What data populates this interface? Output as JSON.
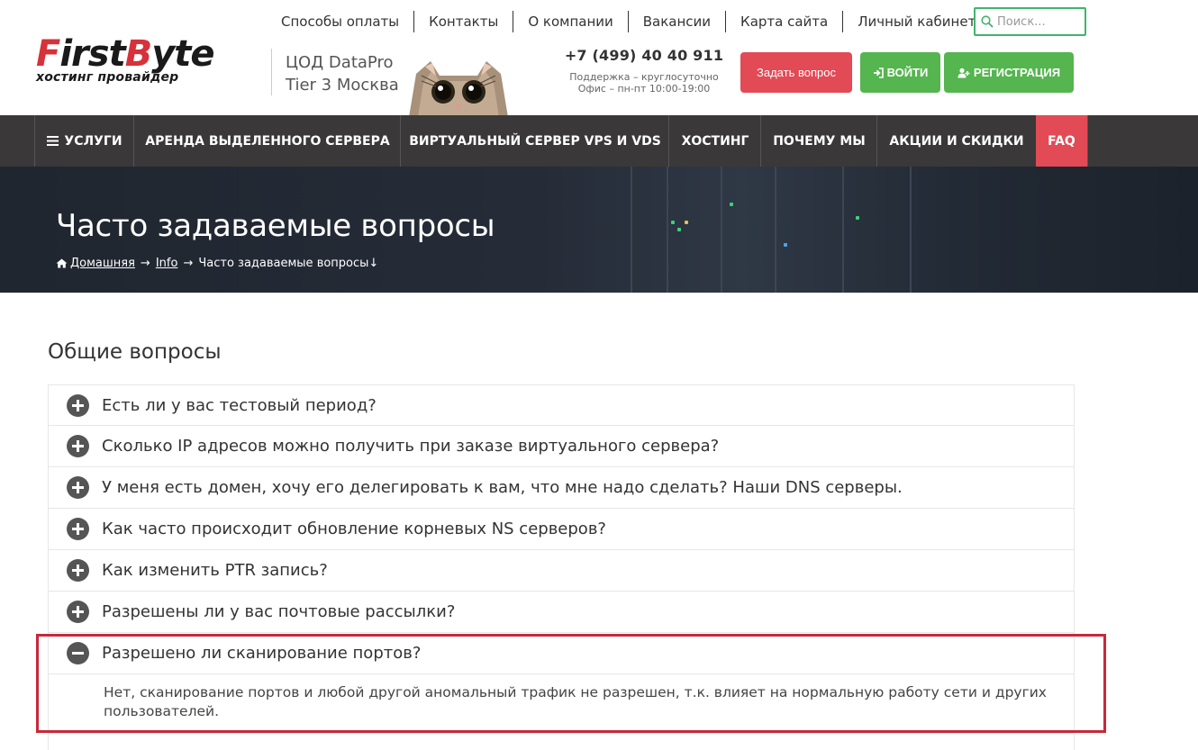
{
  "top_links": [
    "Способы оплаты",
    "Контакты",
    "О компании",
    "Вакансии",
    "Карта сайта",
    "Личный кабинет"
  ],
  "search": {
    "placeholder": "Поиск..."
  },
  "logo": {
    "text_first": "First",
    "text_byte": "Byte",
    "subtitle": "хостинг провайдер"
  },
  "datacenter": {
    "line1": "ЦОД DataPro",
    "line2": "Tier 3 Москва"
  },
  "contact": {
    "phone": "+7 (499) 40 40 911",
    "support": "Поддержка – круглосуточно",
    "office": "Офис – пн-пт 10:00-19:00"
  },
  "buttons": {
    "ask": "Задать вопрос",
    "login": "ВОЙТИ",
    "register": "РЕГИСТРАЦИЯ"
  },
  "nav": [
    "УСЛУГИ",
    "АРЕНДА ВЫДЕЛЕННОГО СЕРВЕРА",
    "ВИРТУАЛЬНЫЙ СЕРВЕР VPS И VDS",
    "ХОСТИНГ",
    "ПОЧЕМУ МЫ",
    "АКЦИИ И СКИДКИ",
    "FAQ"
  ],
  "hero": {
    "title": "Часто задаваемые вопросы",
    "breadcrumb": {
      "home": "Домашняя",
      "info": "Info",
      "current": "Часто задаваемые вопросы↓"
    }
  },
  "faq": {
    "section_title": "Общие вопросы",
    "items": [
      {
        "question": "Есть ли у вас тестовый период?",
        "expanded": false
      },
      {
        "question": "Сколько IP адресов можно получить при заказе виртуального сервера?",
        "expanded": false
      },
      {
        "question": "У меня есть домен, хочу его делегировать к вам, что мне надо сделать? Наши DNS серверы.",
        "expanded": false
      },
      {
        "question": "Как часто происходит обновление корневых NS серверов?",
        "expanded": false
      },
      {
        "question": "Как изменить PTR запись?",
        "expanded": false
      },
      {
        "question": "Разрешены ли у вас почтовые рассылки?",
        "expanded": false
      },
      {
        "question": "Разрешено ли сканирование портов?",
        "expanded": true
      }
    ],
    "answer": "Нет, сканирование портов и любой другой аномальный трафик не разрешен, т.к. влияет на нормальную работу сети и других пользователей."
  },
  "colors": {
    "accent_green": "#55b54f",
    "accent_red": "#e24a55",
    "nav_bg": "#3a3838",
    "highlight": "#c8283a"
  }
}
